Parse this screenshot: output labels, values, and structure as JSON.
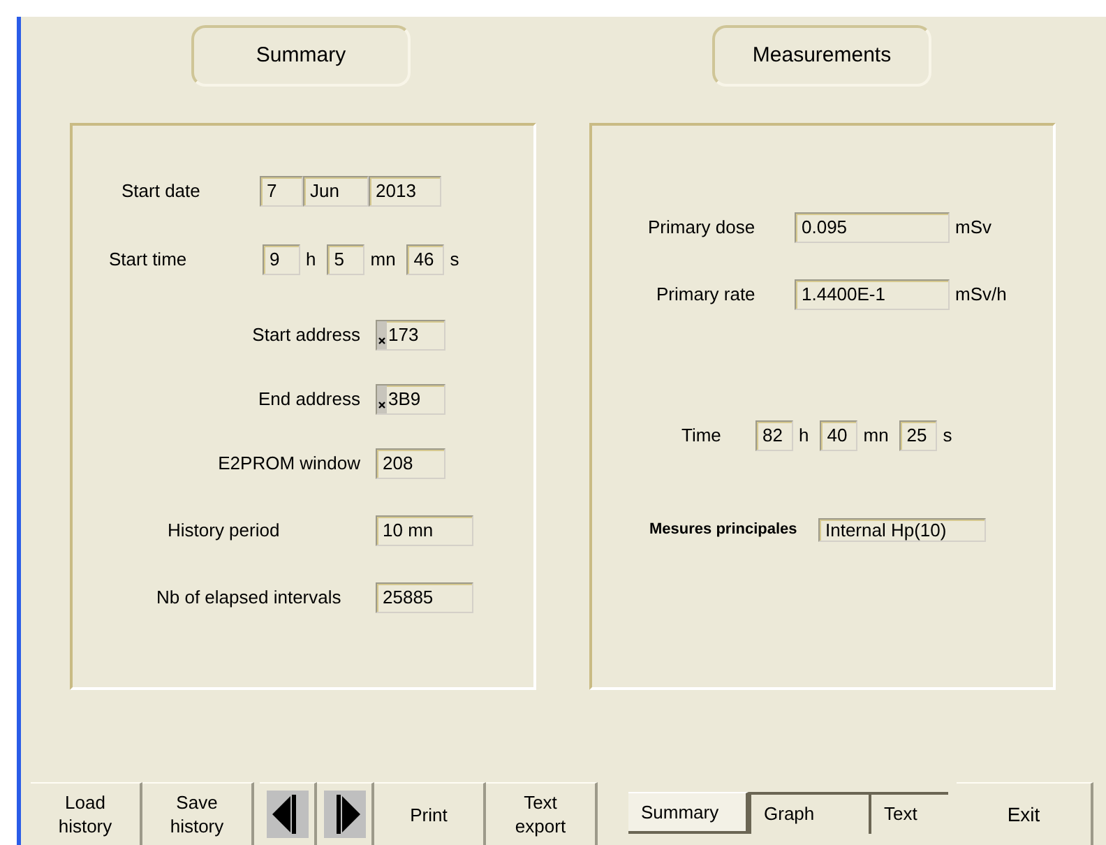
{
  "header_buttons": [
    {
      "label": "Summary"
    },
    {
      "label": "Measurements"
    }
  ],
  "summary_panel": {
    "rows": [
      {
        "kind": "multi",
        "label": "Start date",
        "parts": [
          {
            "value": "7"
          },
          {
            "value": "Jun"
          },
          {
            "value": "2013"
          }
        ]
      },
      {
        "kind": "multi",
        "label": "Start time",
        "parts": [
          {
            "value": "9",
            "unit": "h"
          },
          {
            "value": "5",
            "unit": "mn"
          },
          {
            "value": "46",
            "unit": "s"
          }
        ]
      },
      {
        "kind": "hex",
        "label": "Start address",
        "value": "173"
      },
      {
        "kind": "hex",
        "label": "End address",
        "value": "3B9"
      },
      {
        "kind": "single",
        "label": "E2PROM window",
        "value": "208"
      },
      {
        "kind": "single",
        "label": "History period",
        "value": "10 mn"
      },
      {
        "kind": "single",
        "label": "Nb of elapsed intervals",
        "value": "25885"
      }
    ]
  },
  "measurements_panel": {
    "rows": [
      {
        "kind": "unit",
        "label": "Primary dose",
        "value": "0.095",
        "unit": "mSv"
      },
      {
        "kind": "unit",
        "label": "Primary rate",
        "value": "1.4400E-1",
        "unit": "mSv/h"
      },
      {
        "kind": "multi",
        "label": "Time",
        "parts": [
          {
            "value": "82",
            "unit": "h"
          },
          {
            "value": "40",
            "unit": "mn"
          },
          {
            "value": "25",
            "unit": "s"
          }
        ]
      },
      {
        "kind": "bold",
        "label": "Mesures principales",
        "value": "Internal Hp(10)"
      }
    ]
  },
  "toolbar": [
    {
      "kind": "text",
      "label": "Load",
      "label2": "history"
    },
    {
      "kind": "text",
      "label": "Save",
      "label2": "history"
    },
    {
      "kind": "prev"
    },
    {
      "kind": "next"
    },
    {
      "kind": "text",
      "label": "Print"
    },
    {
      "kind": "text",
      "label": "Text",
      "label2": "export"
    }
  ],
  "view_tabs": [
    {
      "label": "Summary",
      "selected": true
    },
    {
      "label": "Graph",
      "selected": false
    },
    {
      "label": "Text",
      "selected": false
    }
  ],
  "exit_button": {
    "label": "Exit"
  }
}
